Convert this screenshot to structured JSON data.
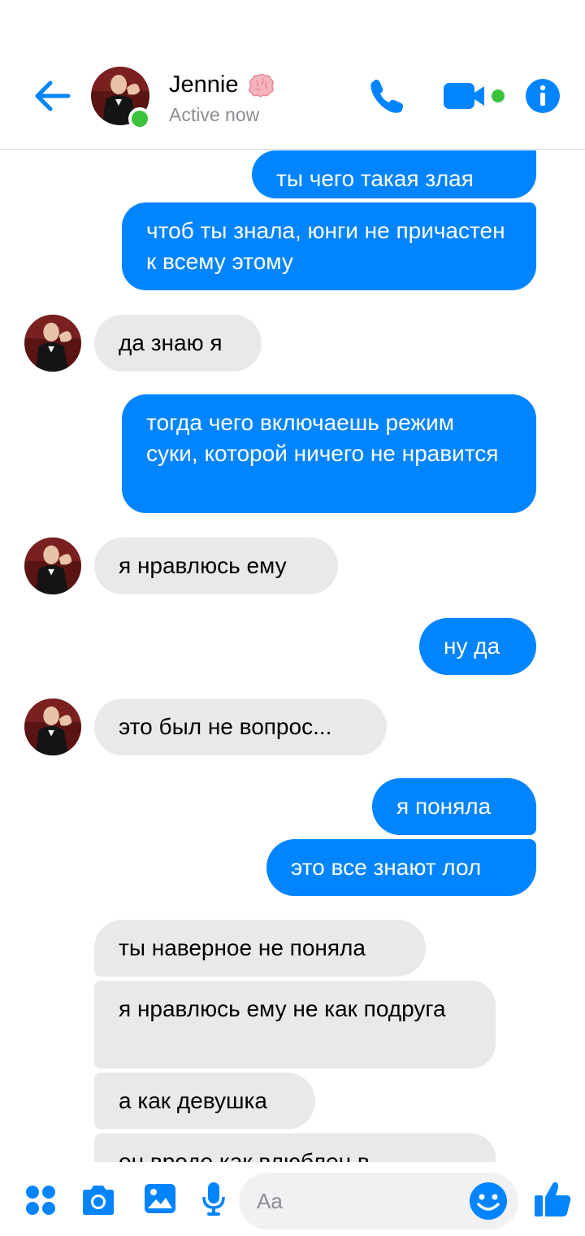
{
  "header": {
    "contact_name": "Jennie",
    "status": "Active now",
    "name_emoji": "brain-icon",
    "online": true
  },
  "messages": [
    {
      "side": "out",
      "text": "ты чего такая злая"
    },
    {
      "side": "out",
      "text": "чтоб ты знала, юнги не причастен к всему этому"
    },
    {
      "side": "in",
      "text": "да знаю я"
    },
    {
      "side": "out",
      "text": "тогда чего включаешь режим суки, которой ничего не нравится"
    },
    {
      "side": "in",
      "text": "я нравлюсь ему"
    },
    {
      "side": "out",
      "text": "ну да"
    },
    {
      "side": "in",
      "text": "это был не вопрос..."
    },
    {
      "side": "out",
      "text": "я поняла"
    },
    {
      "side": "out",
      "text": "это все знают лол"
    },
    {
      "side": "in",
      "text": "ты наверное не поняла"
    },
    {
      "side": "in",
      "text": "я нравлюсь ему не как подруга"
    },
    {
      "side": "in",
      "text": "а как девушка"
    },
    {
      "side": "in",
      "text": "он вроде как влюблен в"
    }
  ],
  "composer": {
    "placeholder": "Aa",
    "icons": [
      "apps-icon",
      "camera-icon",
      "gallery-icon",
      "microphone-icon",
      "emoji-icon",
      "like-icon"
    ]
  },
  "colors": {
    "accent": "#0084ff",
    "incoming_bubble": "#e9e9eb",
    "online": "#3cc33c"
  }
}
